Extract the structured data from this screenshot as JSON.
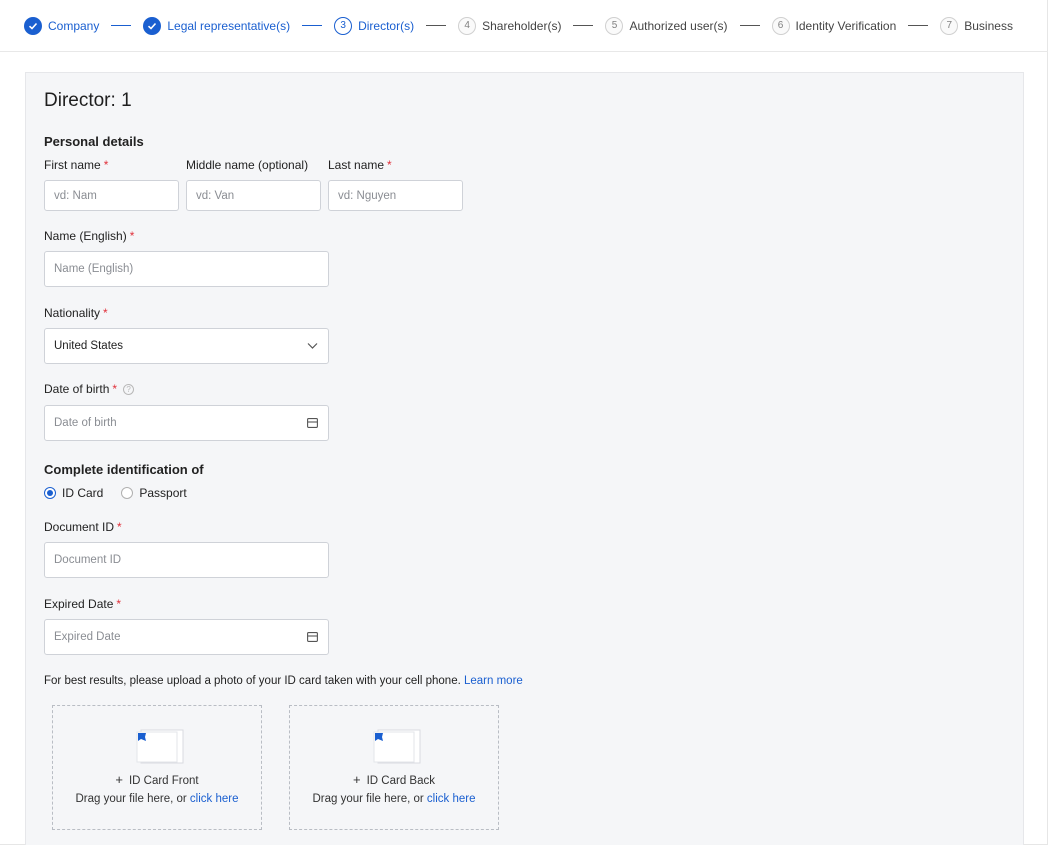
{
  "stepper": {
    "steps": [
      {
        "num": "1",
        "label": "Company",
        "state": "done"
      },
      {
        "num": "2",
        "label": "Legal representative(s)",
        "state": "done"
      },
      {
        "num": "3",
        "label": "Director(s)",
        "state": "active"
      },
      {
        "num": "4",
        "label": "Shareholder(s)",
        "state": "todo"
      },
      {
        "num": "5",
        "label": "Authorized user(s)",
        "state": "todo"
      },
      {
        "num": "6",
        "label": "Identity Verification",
        "state": "todo"
      },
      {
        "num": "7",
        "label": "Business",
        "state": "todo"
      }
    ]
  },
  "form": {
    "title": "Director: 1",
    "personal_section": "Personal details",
    "first_name": {
      "label": "First name",
      "required": "*",
      "placeholder": "vd: Nam"
    },
    "middle_name": {
      "label": "Middle name (optional)",
      "placeholder": "vd: Van"
    },
    "last_name": {
      "label": "Last name",
      "required": "*",
      "placeholder": "vd: Nguyen"
    },
    "name_english": {
      "label": "Name (English)",
      "required": "*",
      "placeholder": "Name (English)"
    },
    "nationality": {
      "label": "Nationality",
      "required": "*",
      "value": "United States"
    },
    "dob": {
      "label": "Date of birth",
      "required": "*",
      "placeholder": "Date of birth",
      "help": "?"
    },
    "id_section": "Complete identification of",
    "id_type": {
      "options": [
        "ID Card",
        "Passport"
      ],
      "selected": "ID Card"
    },
    "document_id": {
      "label": "Document ID",
      "required": "*",
      "placeholder": "Document ID"
    },
    "expired_date": {
      "label": "Expired Date",
      "required": "*",
      "placeholder": "Expired Date"
    },
    "upload_hint": "For best results, please upload a photo of your ID card taken with your cell phone.",
    "learn_more": "Learn more",
    "uploads": [
      {
        "label": "ID Card Front",
        "drag_text": "Drag your file here, or",
        "click_text": "click here"
      },
      {
        "label": "ID Card Back",
        "drag_text": "Drag your file here, or",
        "click_text": "click here"
      }
    ]
  },
  "colors": {
    "accent": "#1a5fd0",
    "required": "#e0303a",
    "card_bg": "#f5f6f8"
  }
}
